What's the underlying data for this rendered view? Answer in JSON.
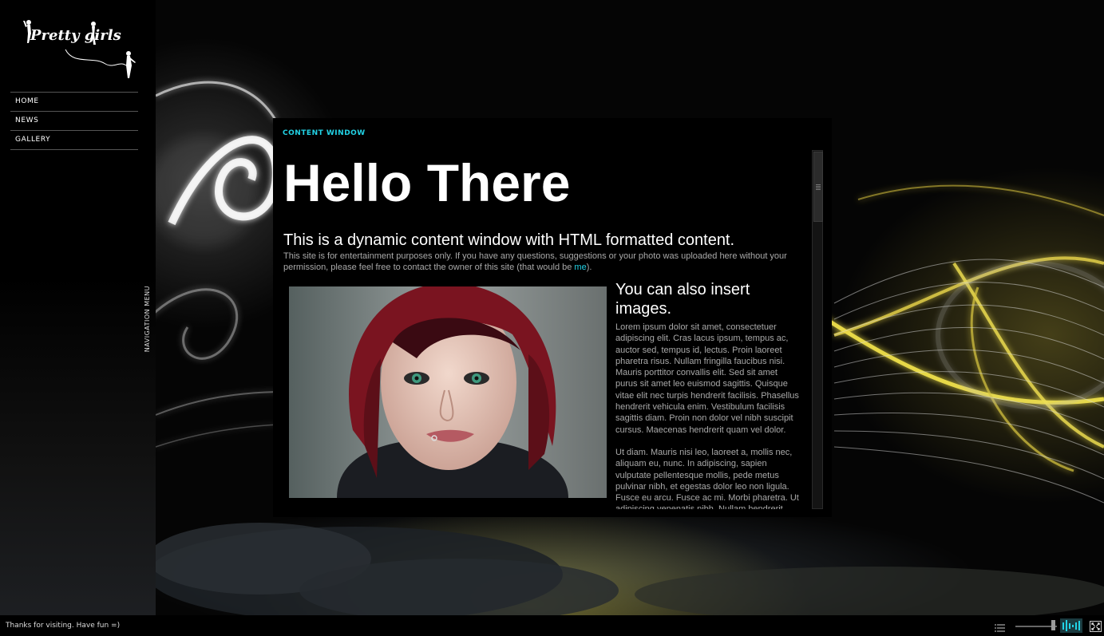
{
  "sidebar": {
    "logo_text": "Pretty girls",
    "nav": [
      {
        "label": "HOME"
      },
      {
        "label": "NEWS"
      },
      {
        "label": "GALLERY"
      }
    ],
    "nav_tab_label": "NAVIGATION MENU"
  },
  "content_window": {
    "title": "CONTENT WINDOW",
    "heading": "Hello There",
    "lead": "This is a dynamic content window with HTML formatted content.",
    "disclaimer_text": "This site is for entertainment purposes only. If you have any questions, suggestions or your photo was uploaded here without your permission, please feel free to contact the owner of this site (that would be ",
    "disclaimer_link": "me",
    "disclaimer_end": ").",
    "image_heading": "You can also insert images.",
    "paragraph_1": "Lorem ipsum dolor sit amet, consectetuer adipiscing elit. Cras lacus ipsum, tempus ac, auctor sed, tempus id, lectus. Proin laoreet pharetra risus. Nullam fringilla faucibus nisi. Mauris porttitor convallis elit. Sed sit amet purus sit amet leo euismod sagittis. Quisque vitae elit nec turpis hendrerit facilisis. Phasellus hendrerit vehicula enim. Vestibulum facilisis sagittis diam. Proin non dolor vel nibh suscipit cursus. Maecenas hendrerit quam vel dolor.",
    "paragraph_2": "Ut diam. Mauris nisi leo, laoreet a, mollis nec, aliquam eu, nunc. In adipiscing, sapien vulputate pellentesque mollis, pede metus pulvinar nibh, et egestas dolor leo non ligula. Fusce eu arcu. Fusce ac mi. Morbi pharetra. Ut adipiscing venenatis nibh. Nullam hendrerit"
  },
  "footer": {
    "text": "Thanks for visiting. Have fun =)"
  },
  "colors": {
    "accent": "#22d3e6",
    "background": "#000000",
    "body_text": "#a9a9a9"
  },
  "icons": [
    "playlist-icon",
    "volume-slider",
    "equalizer-icon",
    "fullscreen-icon"
  ]
}
